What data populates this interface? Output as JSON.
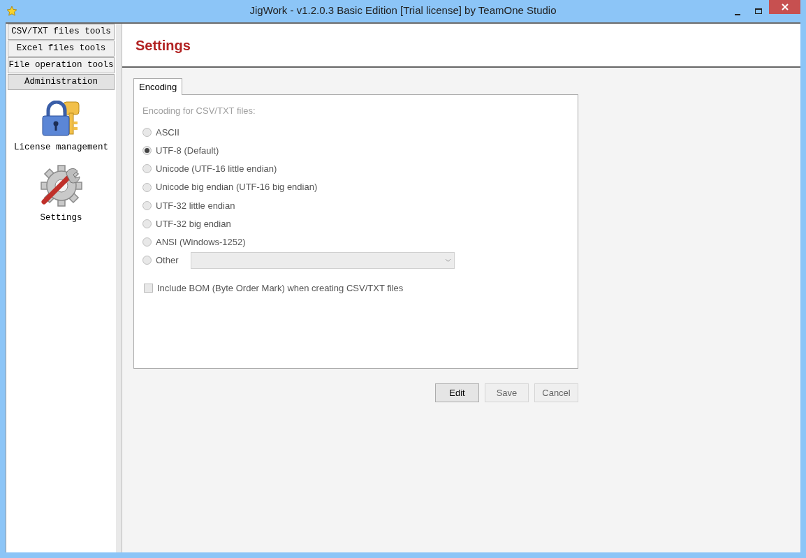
{
  "window": {
    "title": "JigWork - v1.2.0.3 Basic Edition [Trial license] by TeamOne Studio"
  },
  "sidebar": {
    "categories": [
      {
        "label": "CSV/TXT files tools",
        "selected": false
      },
      {
        "label": "Excel files tools",
        "selected": false
      },
      {
        "label": "File operation tools",
        "selected": false
      },
      {
        "label": "Administration",
        "selected": true
      }
    ],
    "items": [
      {
        "kind": "license",
        "label": "License management"
      },
      {
        "kind": "settings",
        "label": "Settings"
      }
    ]
  },
  "page": {
    "title": "Settings"
  },
  "tabs": [
    {
      "label": "Encoding",
      "selected": true
    }
  ],
  "encoding": {
    "heading": "Encoding for CSV/TXT files:",
    "disabled": true,
    "options": [
      {
        "label": "ASCII",
        "selected": false
      },
      {
        "label": "UTF-8 (Default)",
        "selected": true
      },
      {
        "label": "Unicode (UTF-16 little endian)",
        "selected": false
      },
      {
        "label": "Unicode big endian (UTF-16 big endian)",
        "selected": false
      },
      {
        "label": "UTF-32 little endian",
        "selected": false
      },
      {
        "label": "UTF-32 big endian",
        "selected": false
      },
      {
        "label": "ANSI (Windows-1252)",
        "selected": false
      },
      {
        "label": "Other",
        "selected": false,
        "kind": "other"
      }
    ],
    "bom": {
      "label": "Include BOM (Byte Order Mark) when creating CSV/TXT files",
      "checked": false
    }
  },
  "buttons": [
    {
      "label": "Edit",
      "disabled": false
    },
    {
      "label": "Save",
      "disabled": true
    },
    {
      "label": "Cancel",
      "disabled": true
    }
  ]
}
